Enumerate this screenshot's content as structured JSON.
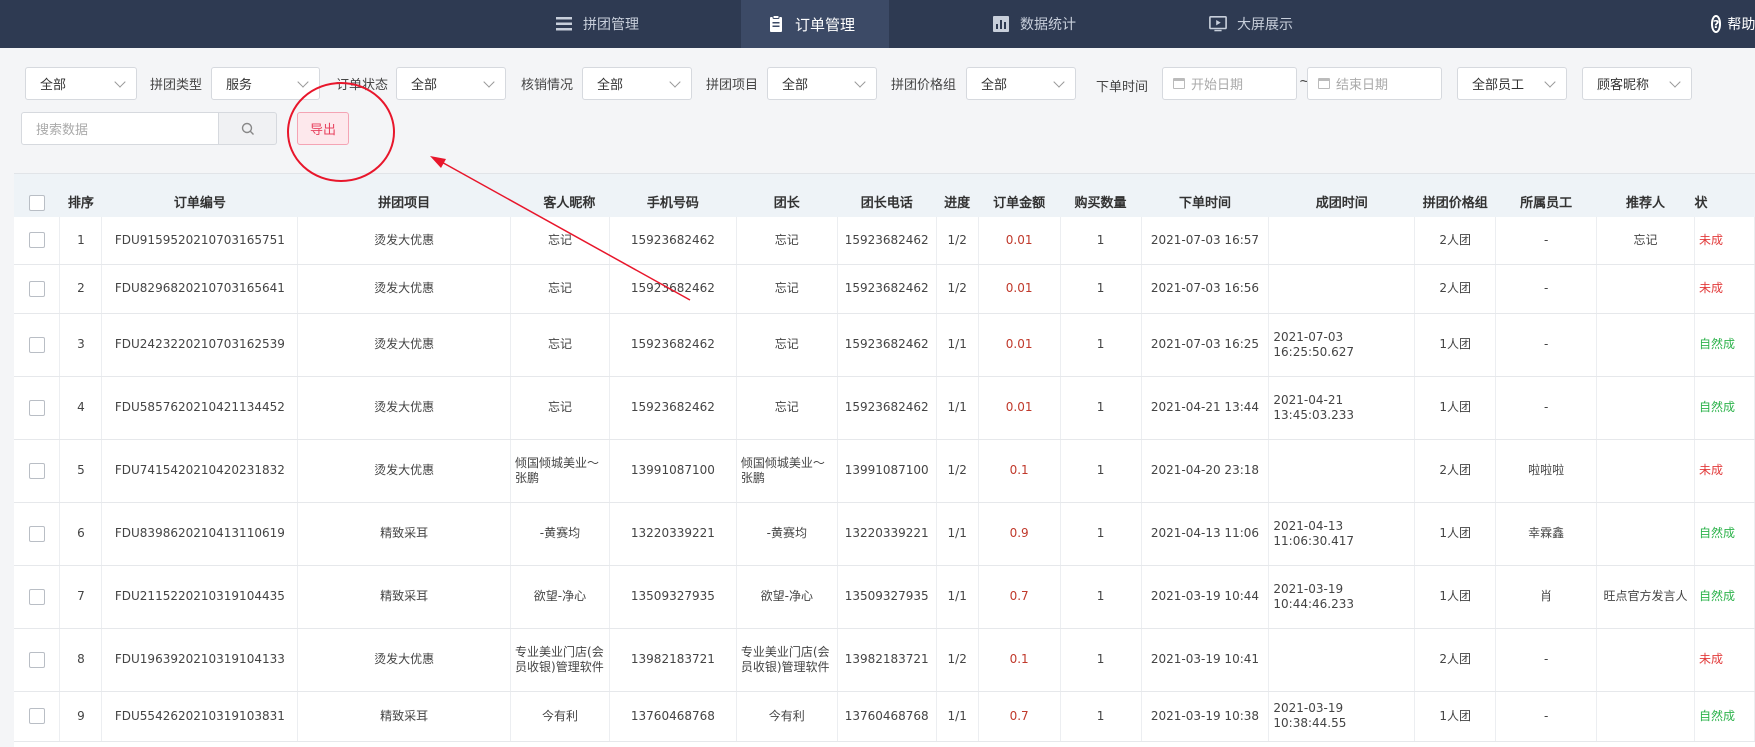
{
  "nav": {
    "items": [
      {
        "label": "拼团管理",
        "active": false
      },
      {
        "label": "订单管理",
        "active": true
      },
      {
        "label": "数据统计",
        "active": false
      },
      {
        "label": "大屏展示",
        "active": false
      }
    ],
    "help_label": "帮助"
  },
  "filters": {
    "first_select": "全部",
    "type_label": "拼团类型",
    "type_value": "服务",
    "status_label": "订单状态",
    "status_value": "全部",
    "verify_label": "核销情况",
    "verify_value": "全部",
    "project_label": "拼团项目",
    "project_value": "全部",
    "price_label": "拼团价格组",
    "price_value": "全部",
    "time_label": "下单时间",
    "start_placeholder": "开始日期",
    "range_sep": "~",
    "end_placeholder": "结束日期",
    "staff_value": "全部员工",
    "nickname_value": "顾客昵称",
    "search_placeholder": "搜索数据",
    "export_label": "导出"
  },
  "table": {
    "headers": [
      "排序",
      "订单编号",
      "拼团项目",
      "客人昵称",
      "手机号码",
      "团长",
      "团长电话",
      "进度",
      "订单金额",
      "购买数量",
      "下单时间",
      "成团时间",
      "拼团价格组",
      "所属员工",
      "推荐人",
      "状"
    ],
    "rows": [
      {
        "no": "1",
        "order": "FDU9159520210703165751",
        "project": "烫发大优惠",
        "nick": "忘记",
        "phone": "15923682462",
        "leader": "忘记",
        "leader_phone": "15923682462",
        "progress": "1/2",
        "amount": "0.01",
        "qty": "1",
        "ordered": "2021-07-03 16:57",
        "formed": "",
        "group": "2人团",
        "staff": "-",
        "ref": "忘记",
        "status": "未成",
        "status_color": "red"
      },
      {
        "no": "2",
        "order": "FDU8296820210703165641",
        "project": "烫发大优惠",
        "nick": "忘记",
        "phone": "15923682462",
        "leader": "忘记",
        "leader_phone": "15923682462",
        "progress": "1/2",
        "amount": "0.01",
        "qty": "1",
        "ordered": "2021-07-03 16:56",
        "formed": "",
        "group": "2人团",
        "staff": "-",
        "ref": "",
        "status": "未成",
        "status_color": "red"
      },
      {
        "no": "3",
        "order": "FDU2423220210703162539",
        "project": "烫发大优惠",
        "nick": "忘记",
        "phone": "15923682462",
        "leader": "忘记",
        "leader_phone": "15923682462",
        "progress": "1/1",
        "amount": "0.01",
        "qty": "1",
        "ordered": "2021-07-03 16:25",
        "formed": "2021-07-03 16:25:50.627",
        "group": "1人团",
        "staff": "-",
        "ref": "",
        "status": "自然成",
        "status_color": "green"
      },
      {
        "no": "4",
        "order": "FDU5857620210421134452",
        "project": "烫发大优惠",
        "nick": "忘记",
        "phone": "15923682462",
        "leader": "忘记",
        "leader_phone": "15923682462",
        "progress": "1/1",
        "amount": "0.01",
        "qty": "1",
        "ordered": "2021-04-21 13:44",
        "formed": "2021-04-21 13:45:03.233",
        "group": "1人团",
        "staff": "-",
        "ref": "",
        "status": "自然成",
        "status_color": "green"
      },
      {
        "no": "5",
        "order": "FDU7415420210420231832",
        "project": "烫发大优惠",
        "nick": "倾国倾城美业～张鹏",
        "phone": "13991087100",
        "leader": "倾国倾城美业～张鹏",
        "leader_phone": "13991087100",
        "progress": "1/2",
        "amount": "0.1",
        "qty": "1",
        "ordered": "2021-04-20 23:18",
        "formed": "",
        "group": "2人团",
        "staff": "啦啦啦",
        "ref": "",
        "status": "未成",
        "status_color": "red"
      },
      {
        "no": "6",
        "order": "FDU8398620210413110619",
        "project": "精致采耳",
        "nick": "-黄赛均",
        "phone": "13220339221",
        "leader": "-黄赛均",
        "leader_phone": "13220339221",
        "progress": "1/1",
        "amount": "0.9",
        "qty": "1",
        "ordered": "2021-04-13 11:06",
        "formed": "2021-04-13 11:06:30.417",
        "group": "1人团",
        "staff": "幸霖鑫",
        "ref": "",
        "status": "自然成",
        "status_color": "green"
      },
      {
        "no": "7",
        "order": "FDU2115220210319104435",
        "project": "精致采耳",
        "nick": "欲望-净心",
        "phone": "13509327935",
        "leader": "欲望-净心",
        "leader_phone": "13509327935",
        "progress": "1/1",
        "amount": "0.7",
        "qty": "1",
        "ordered": "2021-03-19 10:44",
        "formed": "2021-03-19 10:44:46.233",
        "group": "1人团",
        "staff": "肖",
        "ref": "旺点官方发言人",
        "status": "自然成",
        "status_color": "green"
      },
      {
        "no": "8",
        "order": "FDU1963920210319104133",
        "project": "烫发大优惠",
        "nick": "专业美业门店(会员收银)管理软件",
        "phone": "13982183721",
        "leader": "专业美业门店(会员收银)管理软件",
        "leader_phone": "13982183721",
        "progress": "1/2",
        "amount": "0.1",
        "qty": "1",
        "ordered": "2021-03-19 10:41",
        "formed": "",
        "group": "2人团",
        "staff": "-",
        "ref": "",
        "status": "未成",
        "status_color": "red"
      },
      {
        "no": "9",
        "order": "FDU5542620210319103831",
        "project": "精致采耳",
        "nick": "今有利",
        "phone": "13760468768",
        "leader": "今有利",
        "leader_phone": "13760468768",
        "progress": "1/1",
        "amount": "0.7",
        "qty": "1",
        "ordered": "2021-03-19 10:38",
        "formed": "2021-03-19 10:38:44.55",
        "group": "1人团",
        "staff": "-",
        "ref": "",
        "status": "自然成",
        "status_color": "green"
      }
    ]
  },
  "colors": {
    "nav_bg": "#2e3a52",
    "accent_red": "#e8435f",
    "annotation_red": "#e8162b",
    "status_green": "#2eb34c"
  }
}
